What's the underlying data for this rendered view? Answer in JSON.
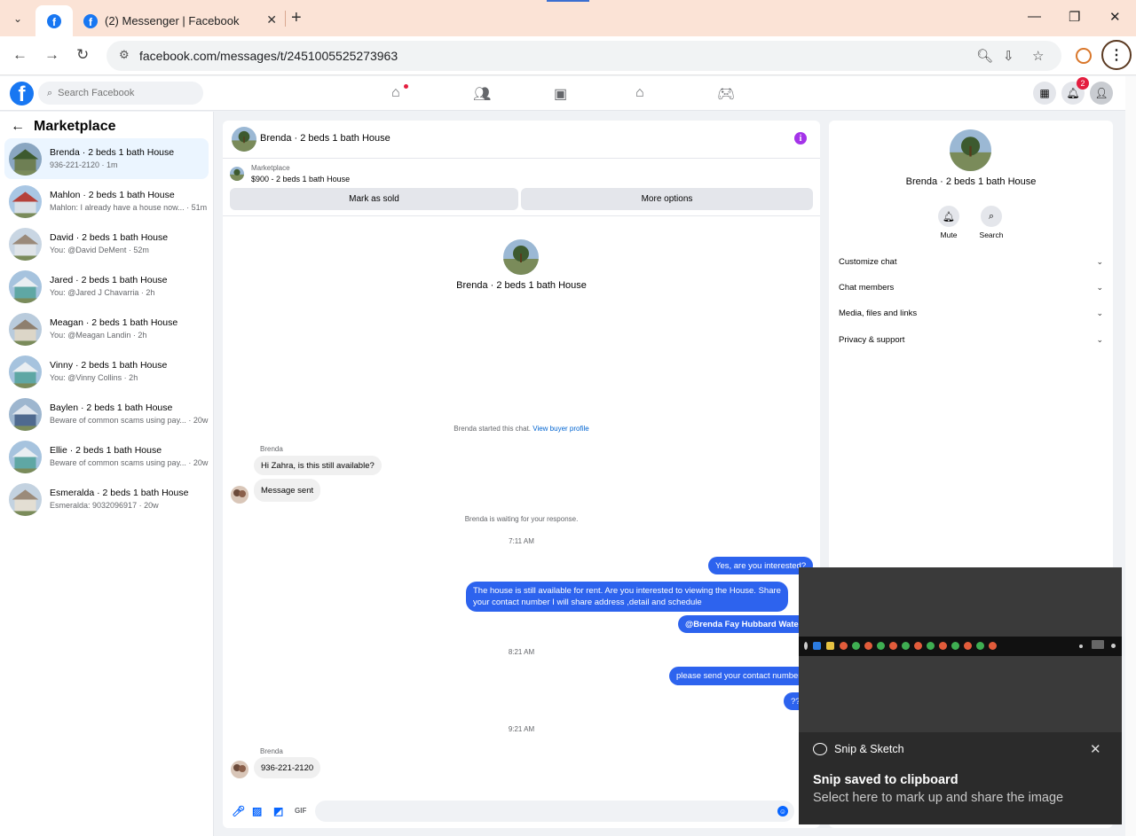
{
  "browser": {
    "tabs": [
      {
        "title": ""
      },
      {
        "title": "(2) Messenger | Facebook"
      }
    ],
    "url": "facebook.com/messages/t/2451005525273963"
  },
  "fb_header": {
    "search_placeholder": "Search Facebook",
    "notification_count": "2"
  },
  "sidebar": {
    "title": "Marketplace",
    "conversations": [
      {
        "name": "Brenda · 2 beds 1 bath House",
        "preview": "936-221-2120 · 1m",
        "active": true
      },
      {
        "name": "Mahlon · 2 beds 1 bath House",
        "preview": "Mahlon: I already have a house now... · 51m"
      },
      {
        "name": "David · 2 beds 1 bath House",
        "preview": "You: @David DeMent · 52m"
      },
      {
        "name": "Jared · 2 beds 1 bath House",
        "preview": "You: @Jared J Chavarria · 2h"
      },
      {
        "name": "Meagan · 2 beds 1 bath House",
        "preview": "You: @Meagan Landin · 2h"
      },
      {
        "name": "Vinny · 2 beds 1 bath House",
        "preview": "You: @Vinny Collins · 2h"
      },
      {
        "name": "Baylen · 2 beds 1 bath House",
        "preview": "Beware of common scams using pay... · 20w"
      },
      {
        "name": "Ellie · 2 beds 1 bath House",
        "preview": "Beware of common scams using pay... · 20w"
      },
      {
        "name": "Esmeralda · 2 beds 1 bath House",
        "preview": "Esmeralda: 9032096917 · 20w"
      }
    ]
  },
  "chat": {
    "header_name": "Brenda · 2 beds 1 bath House",
    "listing_kind": "Marketplace",
    "listing_title": "$900 - 2 beds 1 bath House",
    "mark_sold": "Mark as sold",
    "more_options": "More options",
    "hero_name": "Brenda · 2 beds 1 bath House",
    "started_text": "Brenda started this chat.",
    "view_buyer": "View buyer profile",
    "sender1": "Brenda",
    "msg1": "Hi Zahra, is this still available?",
    "msg2": "Message sent",
    "waiting": "Brenda is waiting for your response.",
    "time1": "7:11 AM",
    "out1": "Yes, are you interested?",
    "out2a": "The house is still available for rent. Are you interested to viewing the House. Share",
    "out2b": "your contact number I will share address ,detail and schedule",
    "out3": "@Brenda Fay Hubbard Water",
    "time2": "8:21 AM",
    "out4": "please send your contact number",
    "out5": "??",
    "time3": "9:21 AM",
    "sender2": "Brenda",
    "msg3": "936-221-2120",
    "composer_value": ""
  },
  "info_panel": {
    "name": "Brenda · 2 beds 1 bath House",
    "mute": "Mute",
    "search": "Search",
    "sections": [
      "Customize chat",
      "Chat members",
      "Media, files and links",
      "Privacy & support"
    ]
  },
  "toast": {
    "app": "Snip & Sketch",
    "title": "Snip saved to clipboard",
    "body": "Select here to mark up and share the image"
  },
  "colors": {
    "accent": "#1877f2",
    "bubble_out": "#2d63ee",
    "tabbar": "#fbe3d6"
  }
}
